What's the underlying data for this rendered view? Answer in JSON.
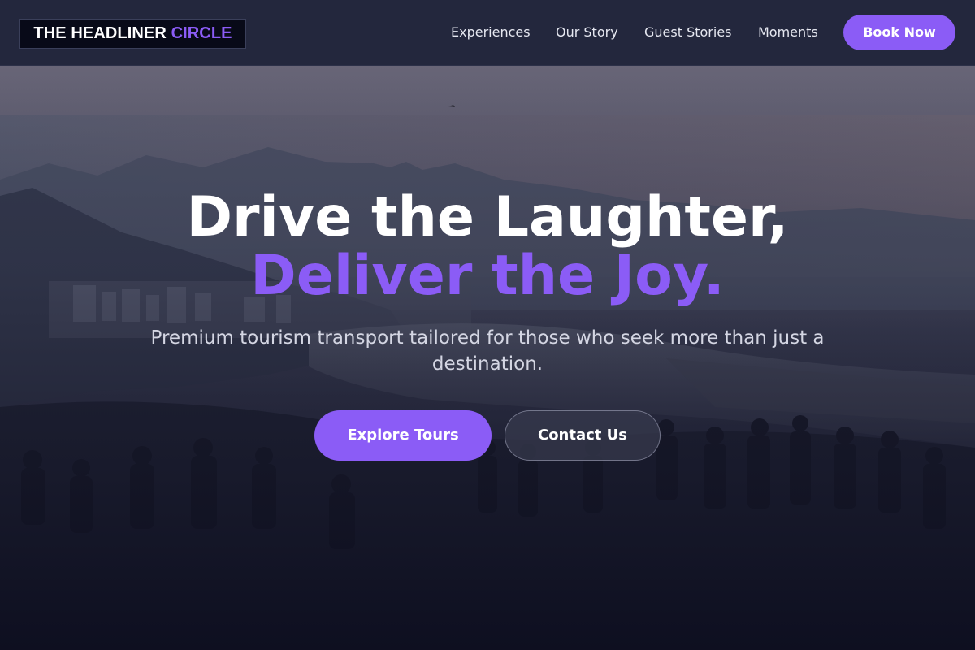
{
  "brand": {
    "name_main": "THE HEADLINER ",
    "name_accent": "CIRCLE"
  },
  "nav": {
    "links": [
      "Experiences",
      "Our Story",
      "Guest Stories",
      "Moments"
    ],
    "cta_label": "Book Now"
  },
  "hero": {
    "headline": "Drive the Laughter,",
    "headline_accent": "Deliver the Joy.",
    "subtitle": "Premium tourism transport tailored for those who seek more than just a destination.",
    "primary_button": "Explore Tours",
    "secondary_button": "Contact Us",
    "background_image": "mountain-city-viewpoint-crowd"
  },
  "colors": {
    "accent": "#8b5cf6",
    "navbar_bg": "#23273d",
    "hero_dark": "#15172b"
  }
}
